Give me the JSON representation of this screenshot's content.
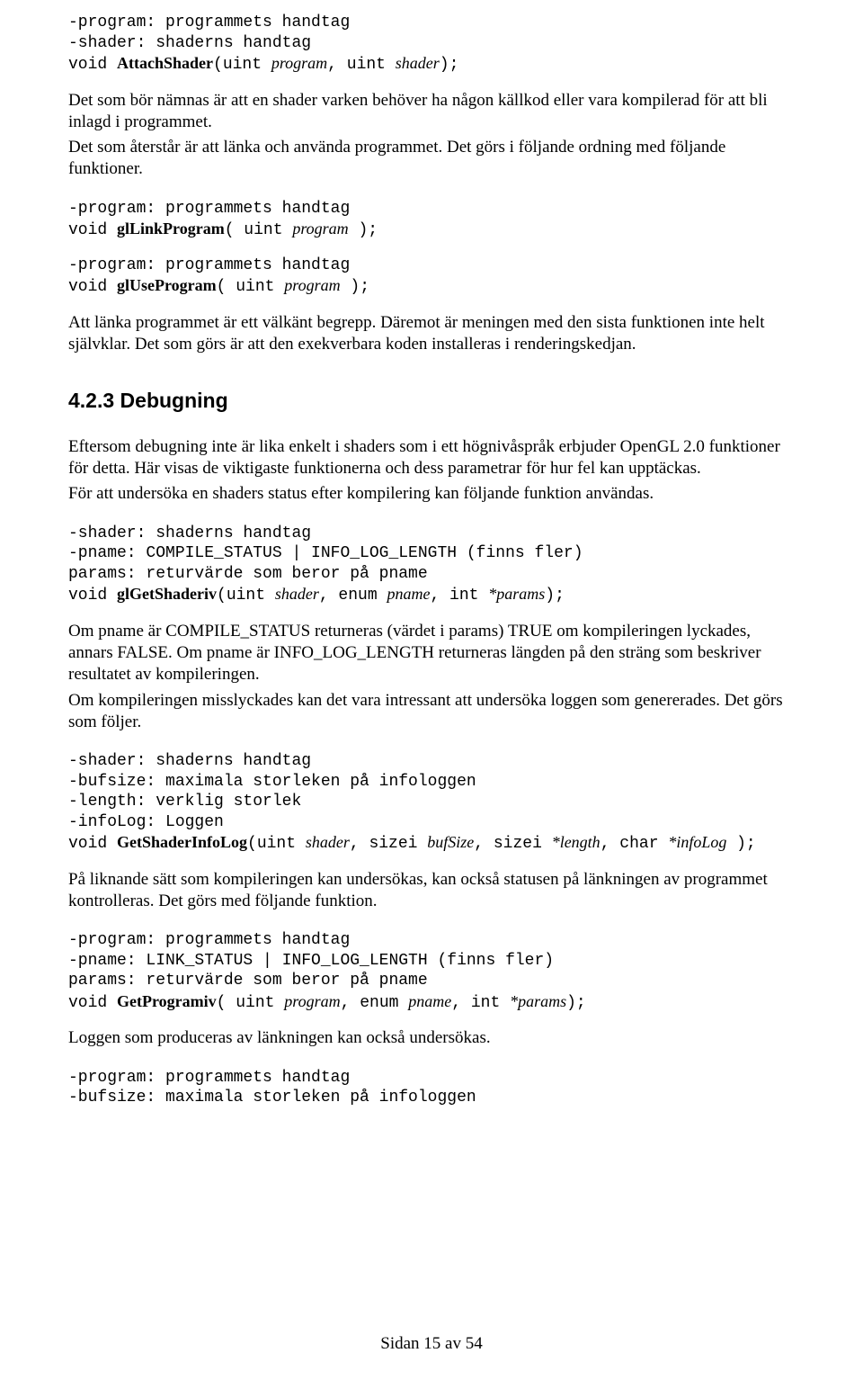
{
  "codeBlock1": {
    "l1": "-program: programmets handtag",
    "l2": "-shader: shaderns handtag",
    "rettype": "void ",
    "fn": "AttachShader",
    "sig1": "(uint ",
    "arg1": "program",
    "sig2": ", uint ",
    "arg2": "shader",
    "sig3": ");"
  },
  "para1": "Det som bör nämnas är att en shader varken behöver ha någon källkod eller vara kompilerad för att bli inlagd i programmet.",
  "para2": "Det som återstår är att länka och använda programmet. Det görs i följande ordning med följande funktioner.",
  "codeBlock2": {
    "l1": "-program: programmets handtag",
    "rettype": "void ",
    "fn": "glLinkProgram",
    "sig1": "( uint ",
    "arg1": "program",
    "sig2": " );"
  },
  "codeBlock3": {
    "l1": "-program: programmets handtag",
    "rettype": "void ",
    "fn": "glUseProgram",
    "sig1": "( uint ",
    "arg1": "program",
    "sig2": " );"
  },
  "para3": "Att länka programmet är ett välkänt begrepp. Däremot är meningen med den sista funktionen inte helt självklar. Det som görs är att den exekverbara koden installeras i renderingskedjan.",
  "heading": "4.2.3 Debugning",
  "para4": "Eftersom debugning inte är lika enkelt i shaders som i ett högnivåspråk erbjuder OpenGL 2.0 funktioner för detta. Här visas de viktigaste funktionerna och dess parametrar för hur fel kan upptäckas.",
  "para5": "För att undersöka en shaders status efter kompilering kan följande funktion användas.",
  "codeBlock4": {
    "l1": "-shader: shaderns handtag",
    "l2": "-pname: COMPILE_STATUS | INFO_LOG_LENGTH (finns fler)",
    "l3": "params: returvärde som beror på pname",
    "rettype": "void ",
    "fn": "glGetShaderiv",
    "sig1": "(uint ",
    "arg1": "shader",
    "sig2": ", enum ",
    "arg2": "pname",
    "sig3": ", int ",
    "arg3": "*params",
    "sig4": ");"
  },
  "para6": "Om pname är COMPILE_STATUS returneras (värdet i params) TRUE om kompileringen lyckades, annars FALSE. Om pname är INFO_LOG_LENGTH returneras längden på den sträng som beskriver resultatet av kompileringen.",
  "para7": "Om kompileringen misslyckades kan det vara intressant att undersöka loggen som genererades. Det görs som följer.",
  "codeBlock5": {
    "l1": "-shader: shaderns handtag",
    "l2": "-bufsize: maximala storleken på infologgen",
    "l3": "-length: verklig storlek",
    "l4": "-infoLog: Loggen",
    "rettype": "void ",
    "fn": "GetShaderInfoLog",
    "sig1": "(uint ",
    "arg1": "shader",
    "sig2": ", sizei ",
    "arg2": "bufSize",
    "sig3": ", sizei ",
    "arg3": "*length",
    "sig4": ", char ",
    "arg4": "*infoLog",
    "sig5": " );"
  },
  "para8": "På liknande sätt som kompileringen kan undersökas, kan också statusen på länkningen av programmet kontrolleras. Det görs med följande funktion.",
  "codeBlock6": {
    "l1": "-program: programmets handtag",
    "l2": "-pname: LINK_STATUS | INFO_LOG_LENGTH (finns fler)",
    "l3": "params: returvärde som beror på pname",
    "rettype": "void ",
    "fn": "GetProgramiv",
    "sig1": "( uint ",
    "arg1": "program",
    "sig2": ", enum ",
    "arg2": "pname",
    "sig3": ", int ",
    "arg3": "*params",
    "sig4": ");"
  },
  "para9": "Loggen som produceras av länkningen kan också undersökas.",
  "codeBlock7": {
    "l1": "-program: programmets handtag",
    "l2": "-bufsize: maximala storleken på infologgen"
  },
  "footer": "Sidan 15 av 54"
}
